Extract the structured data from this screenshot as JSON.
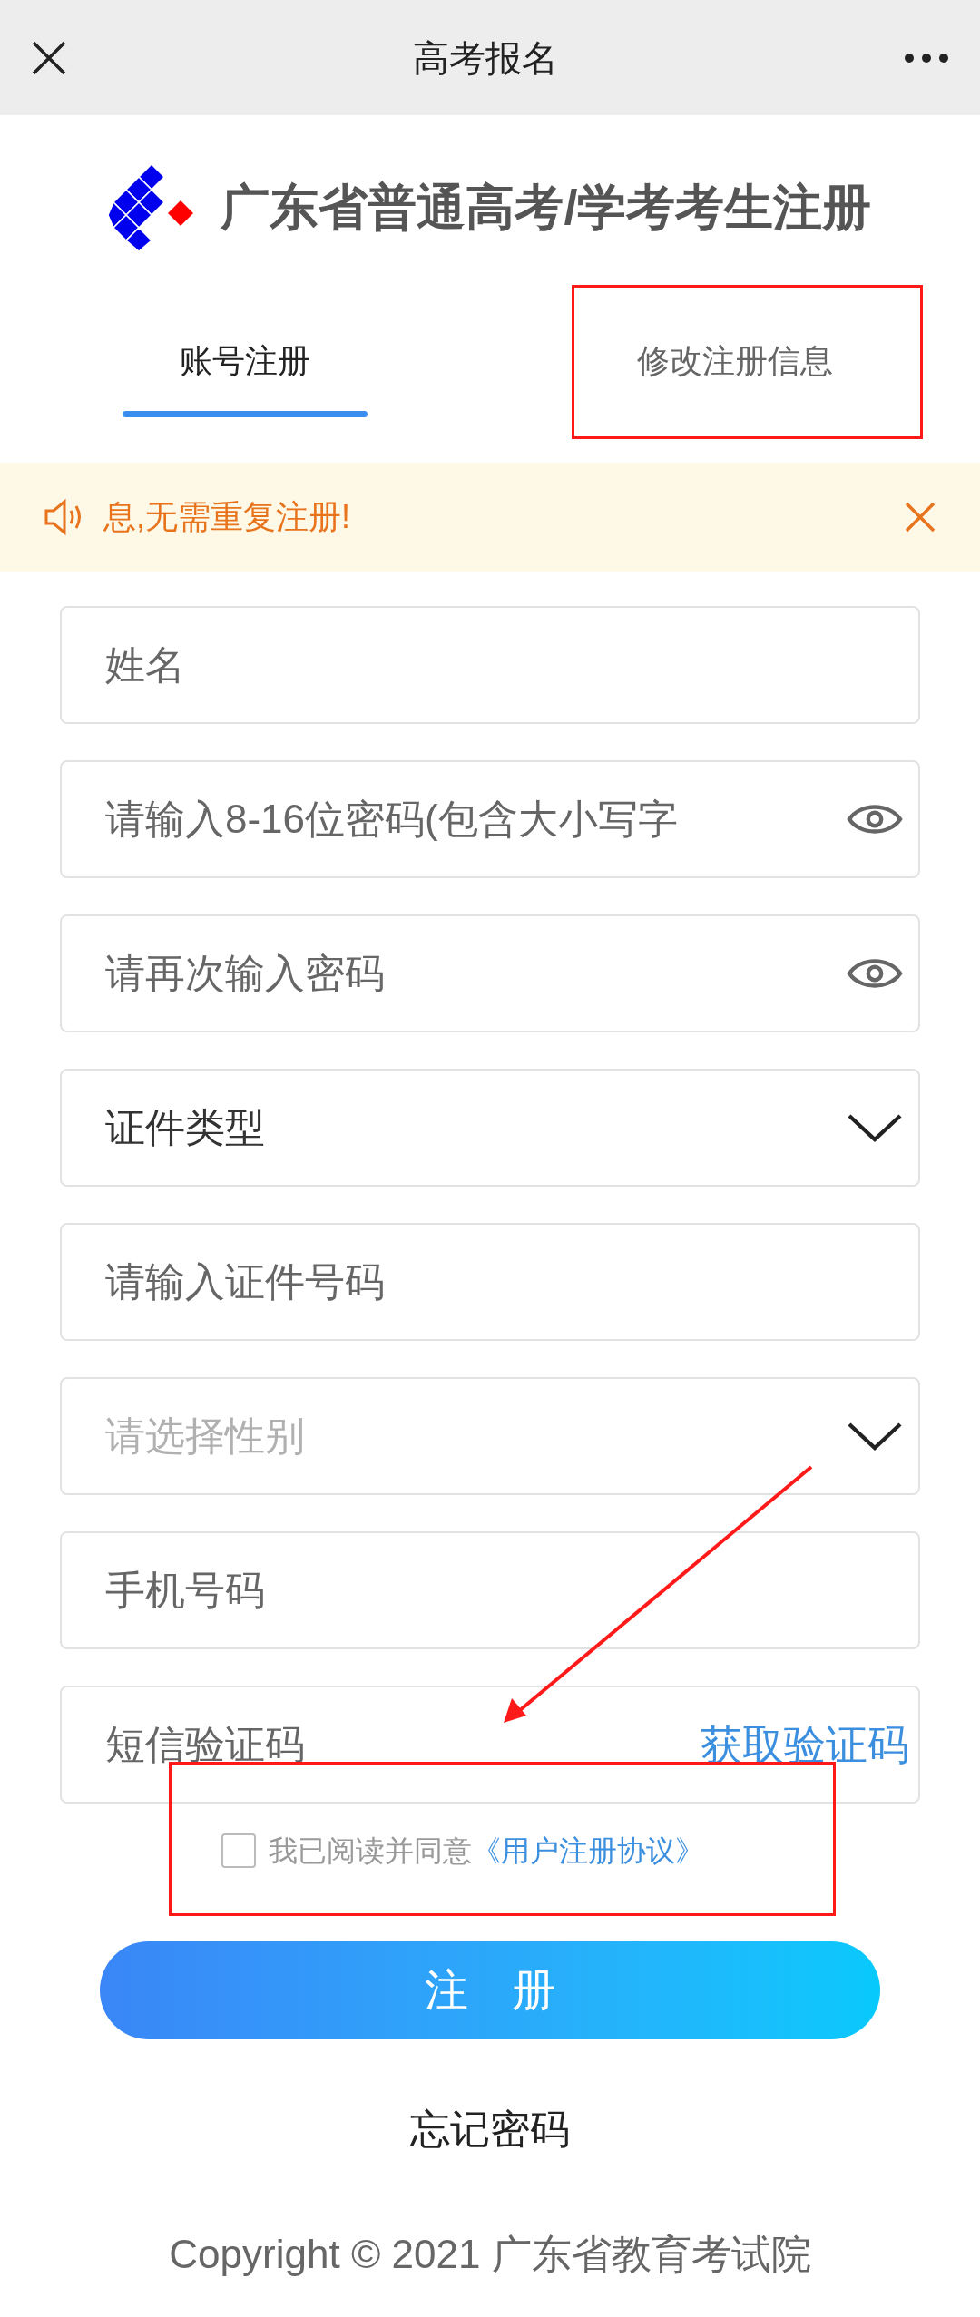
{
  "header": {
    "title": "高考报名"
  },
  "brand": {
    "title": "广东省普通高考/学考考生注册"
  },
  "tabs": [
    {
      "label": "账号注册",
      "selected": true
    },
    {
      "label": "修改注册信息",
      "selected": false
    }
  ],
  "notice": {
    "text": "息,无需重复注册!"
  },
  "fields": [
    {
      "kind": "text",
      "placeholder": "姓名"
    },
    {
      "kind": "password",
      "placeholder": "请输入8-16位密码(包含大小写字"
    },
    {
      "kind": "password",
      "placeholder": "请再次输入密码"
    },
    {
      "kind": "select",
      "value": "证件类型"
    },
    {
      "kind": "text",
      "placeholder": "请输入证件号码"
    },
    {
      "kind": "select",
      "placeholder": "请选择性别"
    },
    {
      "kind": "text",
      "placeholder": "手机号码"
    },
    {
      "kind": "sms",
      "placeholder": "短信验证码",
      "action": "获取验证码"
    }
  ],
  "agreement": {
    "checked": false,
    "text": "我已阅读并同意",
    "link": "《用户注册协议》"
  },
  "submit": "注　册",
  "forgot": "忘记密码",
  "footer": "Copyright © 2021 广东省教育考试院"
}
